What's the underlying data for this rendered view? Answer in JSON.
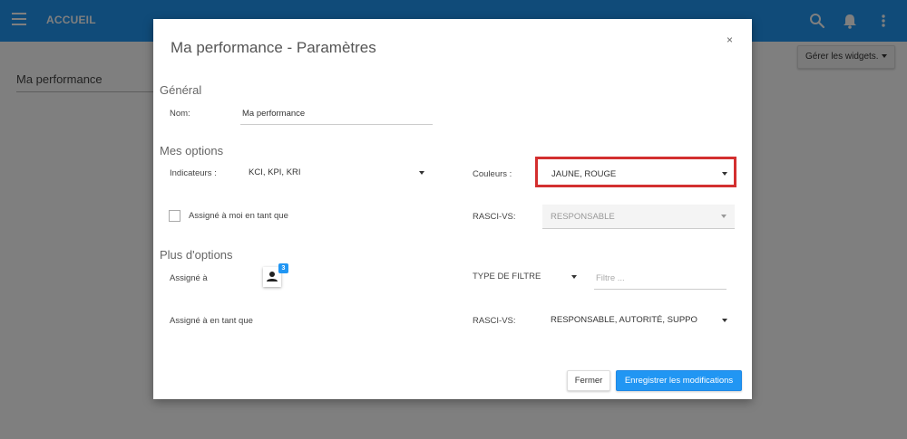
{
  "appbar": {
    "title": "ACCUEIL",
    "icons": [
      "menu-icon",
      "search-icon",
      "bell-icon",
      "more-vert-icon"
    ],
    "color": "#2196f3"
  },
  "page": {
    "title": "Ma performance",
    "widgets_button": "Gérer les widgets."
  },
  "modal": {
    "title": "Ma performance - Paramètres",
    "close": "×",
    "general": {
      "heading": "Général",
      "name_label": "Nom:",
      "name_value": "Ma performance"
    },
    "options": {
      "heading": "Mes options",
      "indicators_label": "Indicateurs :",
      "indicators_value": "KCI, KPI, KRI",
      "colors_label": "Couleurs :",
      "colors_value": "JAUNE, ROUGE",
      "assigned_me_label": "Assigné à moi en tant que",
      "assigned_me_checked": false,
      "rasci_label": "RASCI-VS:",
      "rasci_value": "RESPONSABLE"
    },
    "more_options": {
      "heading": "Plus d'options",
      "assigned_to_label": "Assigné à",
      "assigned_count": "3",
      "filter_type_label": "TYPE DE FILTRE",
      "filter_placeholder": "Filtre ...",
      "assigned_as_label": "Assigné à en tant que",
      "rasci_label": "RASCI-VS:",
      "rasci_value": "RESPONSABLE, AUTORITÉ, SUPPORT, CONS"
    },
    "buttons": {
      "close": "Fermer",
      "save": "Enregistrer les modifications"
    }
  },
  "colors": {
    "accent": "#2196f3",
    "highlight": "#d32f2f"
  }
}
